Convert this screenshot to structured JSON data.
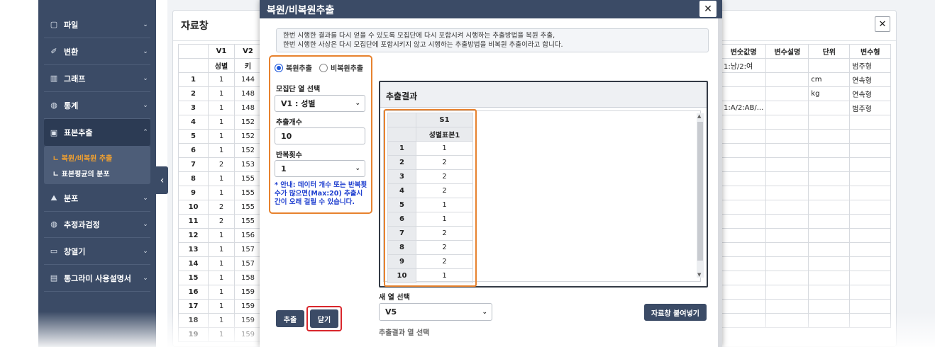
{
  "sidebar": {
    "items": [
      {
        "label": "파일",
        "icon": "file-icon"
      },
      {
        "label": "변환",
        "icon": "wand-icon"
      },
      {
        "label": "그래프",
        "icon": "bar-chart-icon"
      },
      {
        "label": "통계",
        "icon": "globe-icon"
      },
      {
        "label": "표본추출",
        "icon": "image-icon"
      },
      {
        "label": "분포",
        "icon": "mountain-icon"
      },
      {
        "label": "추정과검정",
        "icon": "globe-icon"
      },
      {
        "label": "창열기",
        "icon": "folder-icon"
      },
      {
        "label": "통그라미 사용설명서",
        "icon": "book-icon"
      }
    ],
    "sub_items": [
      {
        "label": "ㄴ 복원/비복원 추출"
      },
      {
        "label": "ㄴ 표본평균의 분포"
      }
    ],
    "accent": "#f0a030"
  },
  "data_panel": {
    "title": "자료창",
    "headers": [
      "V1",
      "V2"
    ],
    "subheaders": [
      "성별",
      "키"
    ],
    "rows": [
      [
        "1",
        "1",
        "144"
      ],
      [
        "2",
        "1",
        "148"
      ],
      [
        "3",
        "1",
        "148"
      ],
      [
        "4",
        "1",
        "152"
      ],
      [
        "5",
        "1",
        "152"
      ],
      [
        "6",
        "1",
        "152"
      ],
      [
        "7",
        "2",
        "153"
      ],
      [
        "8",
        "1",
        "155"
      ],
      [
        "9",
        "1",
        "155"
      ],
      [
        "10",
        "2",
        "155"
      ],
      [
        "11",
        "2",
        "155"
      ],
      [
        "12",
        "1",
        "156"
      ],
      [
        "13",
        "1",
        "157"
      ],
      [
        "14",
        "1",
        "157"
      ],
      [
        "15",
        "1",
        "158"
      ],
      [
        "16",
        "1",
        "159"
      ],
      [
        "17",
        "1",
        "159"
      ],
      [
        "18",
        "1",
        "159"
      ],
      [
        "19",
        "1",
        "159"
      ]
    ],
    "var_headers": [
      "변숫값명",
      "변수설명",
      "단위",
      "변수형"
    ],
    "var_rows": [
      [
        "1:남/2:여",
        "",
        "",
        "범주형"
      ],
      [
        "",
        "",
        "cm",
        "연속형"
      ],
      [
        "",
        "",
        "kg",
        "연속형"
      ],
      [
        "1:A/2:AB/...",
        "",
        "",
        "범주형"
      ]
    ]
  },
  "modal": {
    "title": "복원/비복원추출",
    "notice_line1": "한번 시행한 결과를 다시 얻을 수 있도록 모집단에 다시 포함시켜 시행하는 추출방법을 복원 추출,",
    "notice_line2": "한번 시행한 사상은 다시 모집단에 포함시키지 않고 시행하는 추출방법을 비복원 추출이라고 합니다.",
    "radio_with": "복원추출",
    "radio_without": "비복원추출",
    "col_label": "모집단 열 선택",
    "col_value": "V1 : 성별",
    "count_label": "추출개수",
    "count_value": "10",
    "repeat_label": "반복횟수",
    "repeat_value": "1",
    "guide": "* 안내: 데이터 개수 또는 반복횟수가 많으면(Max:20) 추출시간이 오래 걸릴 수 있습니다.",
    "result_title": "추출결과",
    "result_col": "S1",
    "result_sub": "성별표본1",
    "result_rows": [
      [
        "1",
        "1"
      ],
      [
        "2",
        "2"
      ],
      [
        "3",
        "2"
      ],
      [
        "4",
        "2"
      ],
      [
        "5",
        "1"
      ],
      [
        "6",
        "1"
      ],
      [
        "7",
        "2"
      ],
      [
        "8",
        "2"
      ],
      [
        "9",
        "2"
      ],
      [
        "10",
        "1"
      ]
    ],
    "new_col_label": "새 열 선택",
    "new_col_value": "V5",
    "paste_btn": "자료창 붙여넣기",
    "extract_btn": "추출",
    "close_btn": "닫기",
    "ext_col_label": "추출결과 열 선택"
  }
}
